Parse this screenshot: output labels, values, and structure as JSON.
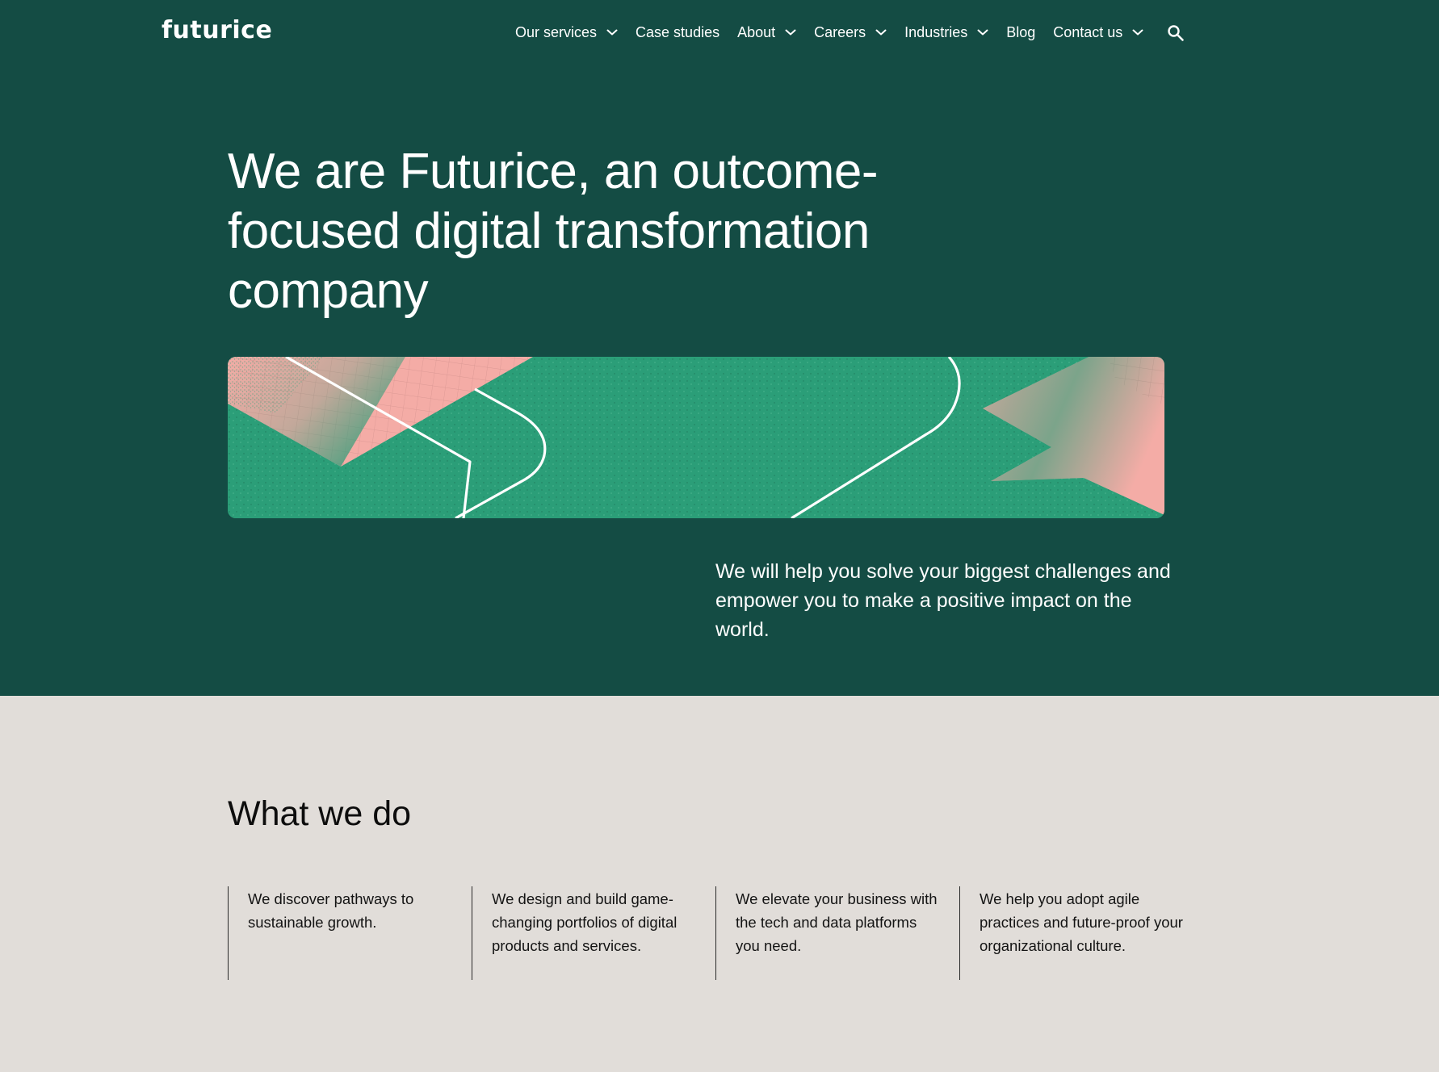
{
  "brand": {
    "logo_text": "futurice",
    "colors": {
      "hero_bg": "#144c44",
      "page_bg": "#e1ddd9",
      "banner_green": "#2b9e78",
      "banner_pink": "#f4aca6"
    }
  },
  "nav": {
    "items": [
      {
        "label": "Our services",
        "has_dropdown": true
      },
      {
        "label": "Case studies",
        "has_dropdown": false
      },
      {
        "label": "About",
        "has_dropdown": true
      },
      {
        "label": "Careers",
        "has_dropdown": true
      },
      {
        "label": "Industries",
        "has_dropdown": true
      },
      {
        "label": "Blog",
        "has_dropdown": false
      },
      {
        "label": "Contact us",
        "has_dropdown": true
      }
    ],
    "search_icon": "search-icon"
  },
  "hero": {
    "title": "We are Futurice, an outcome-focused digital transformation company",
    "subtitle": "We will help you solve your biggest challenges and empower you to make a positive impact on the world."
  },
  "what_we_do": {
    "title": "What we do",
    "columns": [
      "We discover pathways to sustainable growth.",
      "We design and build game-changing portfolios of digital products and services.",
      "We elevate your business with the tech and data platforms you need.",
      "We help you adopt agile practices and future-proof your organizational culture."
    ]
  }
}
